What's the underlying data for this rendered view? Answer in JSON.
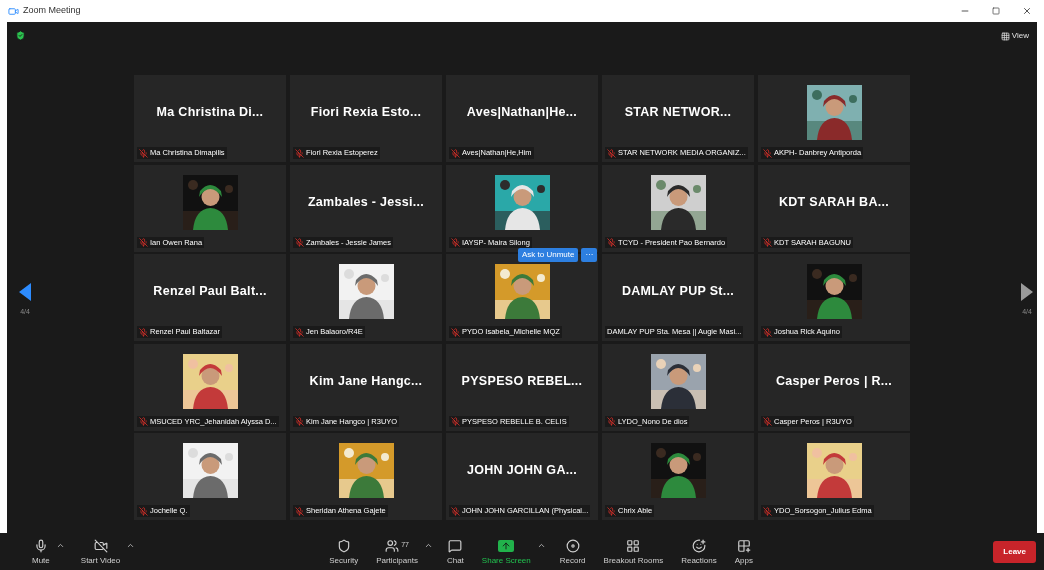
{
  "window": {
    "title": "Zoom Meeting"
  },
  "view_button": {
    "label": "View"
  },
  "prev_page": {
    "label": "4/4",
    "enabled": true
  },
  "next_page": {
    "label": "4/4",
    "enabled": false
  },
  "tiles": [
    {
      "kind": "name",
      "display": "Ma Christina Di...",
      "name": "Ma Christina Dimapilis",
      "muted": true
    },
    {
      "kind": "name",
      "display": "Fiori Rexia Esto...",
      "name": "Fiori Rexia Estoperez",
      "muted": true
    },
    {
      "kind": "name",
      "display": "Aves|Nathan|He...",
      "name": "Aves|Nathan|He,Him",
      "muted": true
    },
    {
      "kind": "name",
      "display": "STAR NETWOR...",
      "name": "STAR NETWORK MEDIA ORGANIZ...",
      "muted": true
    },
    {
      "kind": "picture",
      "name": "AKPH- Danbrey Antiporda",
      "muted": true
    },
    {
      "kind": "picture",
      "name": "Ian Owen Rana",
      "muted": true
    },
    {
      "kind": "name",
      "display": "Zambales - Jessi...",
      "name": "Zambales - Jessie James",
      "muted": true
    },
    {
      "kind": "picture",
      "name": "IAYSP- Maira Silong",
      "muted": true
    },
    {
      "kind": "picture",
      "name": "TCYD - President Pao Bernardo",
      "muted": true
    },
    {
      "kind": "name",
      "display": "KDT SARAH BA...",
      "name": "KDT SARAH BAGUNU",
      "muted": true
    },
    {
      "kind": "name",
      "display": "Renzel Paul Balt...",
      "name": "Renzel Paul Baltazar",
      "muted": true
    },
    {
      "kind": "picture",
      "name": "Jen Balaoro/R4E",
      "muted": true
    },
    {
      "kind": "picture",
      "name": "PYDO Isabela_Michelle MQZ",
      "muted": true,
      "actions": [
        "Ask to Unmute",
        "···"
      ]
    },
    {
      "kind": "name",
      "display": "DAMLAY PUP St...",
      "name": "DAMLAY PUP Sta. Mesa || Augie Masi...",
      "muted": false
    },
    {
      "kind": "picture",
      "name": "Joshua Rick Aquino",
      "muted": true
    },
    {
      "kind": "picture",
      "name": "MSUCED YRC_Jehanidah Alyssa D...",
      "muted": true
    },
    {
      "kind": "name",
      "display": "Kim Jane Hangc...",
      "name": "Kim Jane Hangco | R3UYO",
      "muted": true
    },
    {
      "kind": "name",
      "display": "PYSPESO REBEL...",
      "name": "PYSPESO REBELLE B. CELIS",
      "muted": true
    },
    {
      "kind": "picture",
      "name": "LYDO_Nono De dios",
      "muted": true
    },
    {
      "kind": "name",
      "display": "Casper Peros | R...",
      "name": "Casper Peros | R3UYO",
      "muted": true
    },
    {
      "kind": "picture",
      "name": "Jochelle Q.",
      "muted": true
    },
    {
      "kind": "picture",
      "name": "Sheridan Athena Gajete",
      "muted": true
    },
    {
      "kind": "name",
      "display": "JOHN JOHN GA...",
      "name": "JOHN JOHN GARCILLAN (Physical...",
      "muted": true
    },
    {
      "kind": "picture",
      "name": "Chrix Able",
      "muted": true
    },
    {
      "kind": "picture",
      "name": "YDO_Sorsogon_Julius Edma",
      "muted": true
    }
  ],
  "toolbar_left": [
    {
      "kind": "mic",
      "label": "Mute",
      "menu": true
    },
    {
      "kind": "video-off",
      "label": "Start Video",
      "menu": true
    }
  ],
  "toolbar_center": [
    {
      "kind": "security",
      "label": "Security",
      "menu": false
    },
    {
      "kind": "participants",
      "label": "Participants",
      "count": "77",
      "menu": true
    },
    {
      "kind": "chat",
      "label": "Chat",
      "menu": false
    },
    {
      "kind": "share",
      "label": "Share Screen",
      "menu": true,
      "highlighted": true
    },
    {
      "kind": "record",
      "label": "Record",
      "menu": false
    },
    {
      "kind": "breakout",
      "label": "Breakout Rooms",
      "menu": false
    },
    {
      "kind": "reactions",
      "label": "Reactions",
      "menu": false
    },
    {
      "kind": "apps",
      "label": "Apps",
      "menu": false
    }
  ],
  "leave_button": {
    "label": "Leave"
  }
}
